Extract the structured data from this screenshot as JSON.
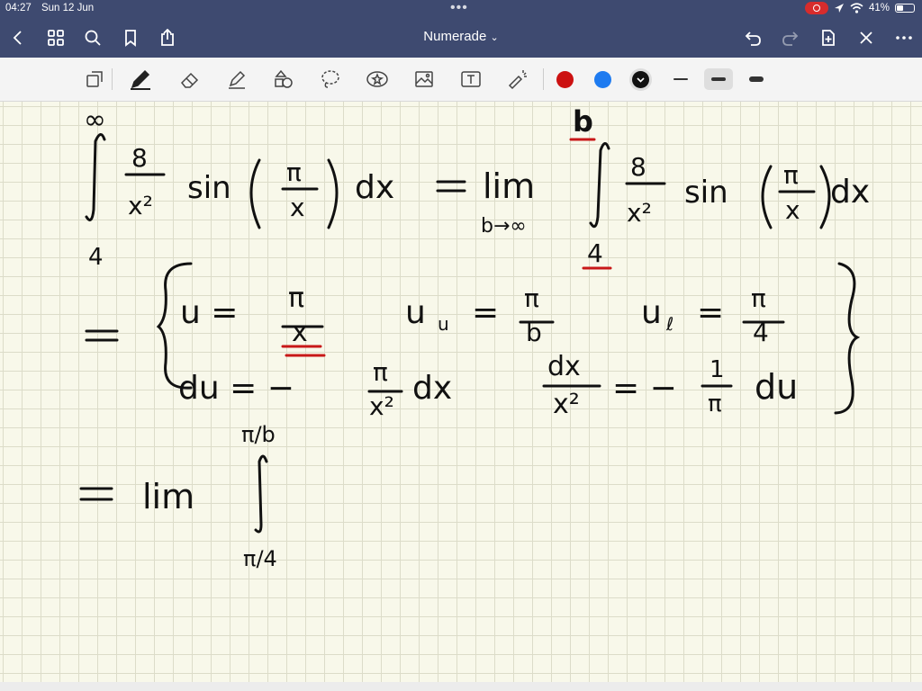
{
  "status_bar": {
    "time": "04:27",
    "date": "Sun 12 Jun",
    "battery": "41%",
    "battery_level": 0.41
  },
  "nav_bar": {
    "title": "Numerade",
    "title_chevron": "⌄"
  },
  "toolbar": {
    "tools": [
      "convert-icon",
      "pen-icon",
      "eraser-icon",
      "highlighter-icon",
      "shapes-icon",
      "lasso-icon",
      "sticker-icon",
      "image-icon",
      "text-icon",
      "laser-pointer-icon"
    ],
    "colors": [
      "#cc1111",
      "#1e7bf0",
      "#111111"
    ],
    "selected_color": "#111111",
    "selected_thickness": "medium"
  },
  "note": {
    "line1": {
      "upper": "∞",
      "numerator": "8",
      "denominator": "x²",
      "function": "sin",
      "pi_num": "π",
      "pi_den": "x",
      "dx": "dx",
      "equals": "=",
      "lim": "lim",
      "lim_sub": "b→∞",
      "upper_r": "b",
      "numerator_r": "8",
      "denominator_r": "x²",
      "function_r": "sin",
      "pi_num_r": "π",
      "pi_den_r": "x",
      "dx_r": "dx",
      "lower": "4",
      "lower_r": "4"
    },
    "line2": {
      "equals": "=",
      "u": "u =",
      "u_num": "π",
      "u_den": "x",
      "uu": "u",
      "uu_sub": "u",
      "uu_eq": "=",
      "uu_num": "π",
      "uu_den": "b",
      "ul": "u",
      "ul_sub": "ℓ",
      "ul_eq": "=",
      "ul_num": "π",
      "ul_den": "4"
    },
    "line3": {
      "du": "du = −",
      "du_num": "π",
      "du_den": "x²",
      "du_dx": "dx",
      "frac_num": "dx",
      "frac_den": "x²",
      "eq": "= −",
      "one_num": "1",
      "one_den": "π",
      "du_tail": "du"
    },
    "line4": {
      "equals": "=",
      "lim": "lim",
      "upper": "π/b",
      "lower": "π/4"
    }
  }
}
